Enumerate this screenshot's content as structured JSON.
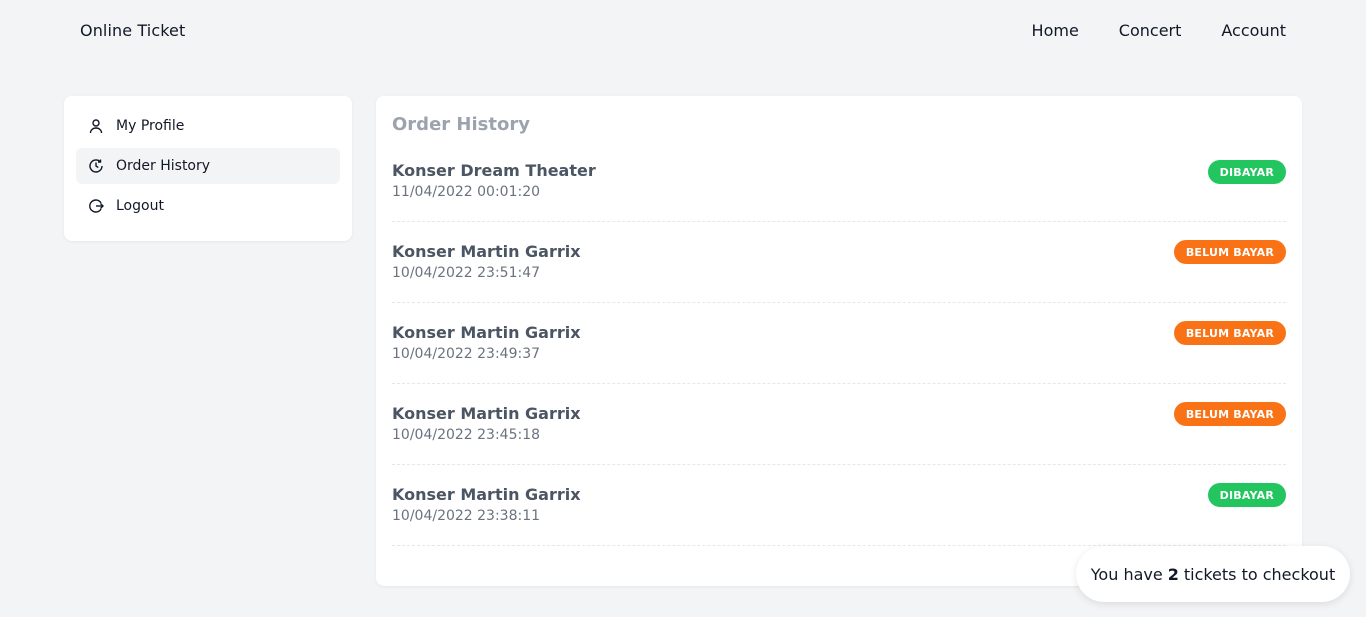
{
  "navbar": {
    "brand": "Online Ticket",
    "links": [
      "Home",
      "Concert",
      "Account"
    ]
  },
  "sidebar": {
    "items": [
      {
        "label": "My Profile",
        "icon": "user-icon"
      },
      {
        "label": "Order History",
        "icon": "history-icon"
      },
      {
        "label": "Logout",
        "icon": "logout-icon"
      }
    ],
    "active_index": 1
  },
  "main": {
    "title": "Order History",
    "orders": [
      {
        "name": "Konser Dream Theater",
        "date": "11/04/2022 00:01:20",
        "status": "DIBAYAR",
        "status_color": "#22c55e"
      },
      {
        "name": "Konser Martin Garrix",
        "date": "10/04/2022 23:51:47",
        "status": "BELUM BAYAR",
        "status_color": "#f97316"
      },
      {
        "name": "Konser Martin Garrix",
        "date": "10/04/2022 23:49:37",
        "status": "BELUM BAYAR",
        "status_color": "#f97316"
      },
      {
        "name": "Konser Martin Garrix",
        "date": "10/04/2022 23:45:18",
        "status": "BELUM BAYAR",
        "status_color": "#f97316"
      },
      {
        "name": "Konser Martin Garrix",
        "date": "10/04/2022 23:38:11",
        "status": "DIBAYAR",
        "status_color": "#22c55e"
      }
    ]
  },
  "checkout": {
    "prefix": "You have",
    "count": "2",
    "suffix": "tickets to checkout"
  }
}
